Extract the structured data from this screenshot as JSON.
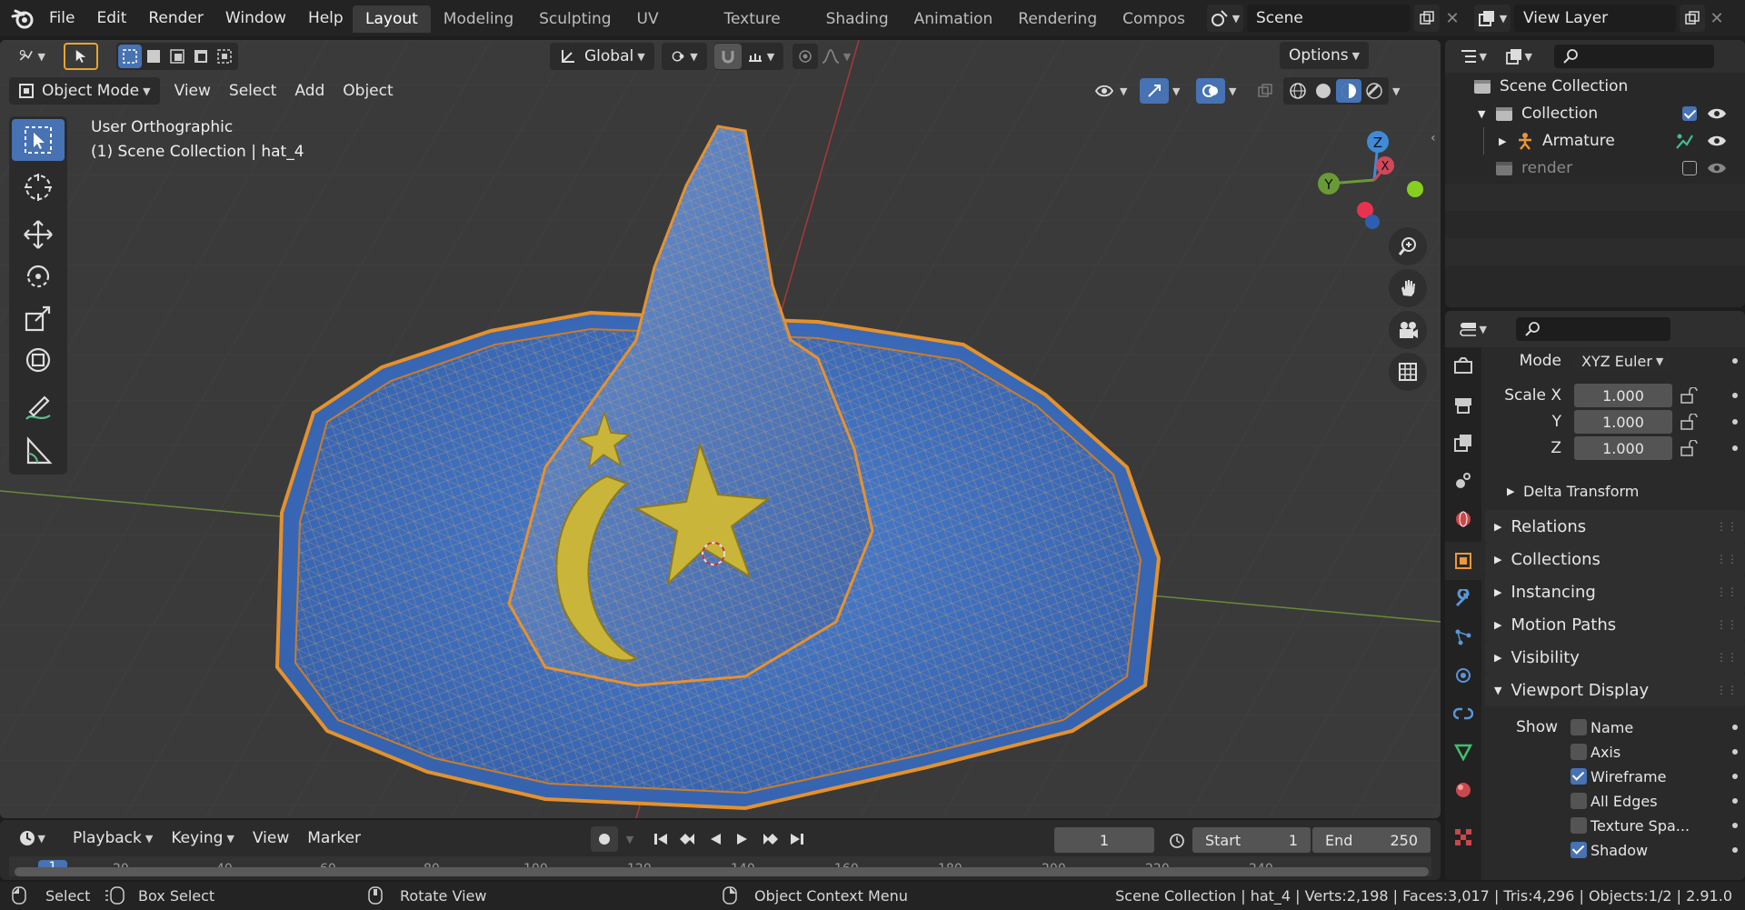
{
  "topbar": {
    "menus": [
      "File",
      "Edit",
      "Render",
      "Window",
      "Help"
    ],
    "workspaces": [
      "Layout",
      "Modeling",
      "Sculpting",
      "UV Editing",
      "Texture Paint",
      "Shading",
      "Animation",
      "Rendering",
      "Compos"
    ],
    "active_workspace": "Layout",
    "scene_label": "Scene",
    "view_layer_label": "View Layer"
  },
  "viewport": {
    "transform_orientation": "Global",
    "options_label": "Options",
    "mode_label": "Object Mode",
    "header_menus": [
      "View",
      "Select",
      "Add",
      "Object"
    ],
    "view_name": "User Orthographic",
    "context_line": "(1) Scene Collection | hat_4",
    "gizmo": {
      "z": "Z",
      "y": "Y",
      "x": "X"
    }
  },
  "outliner": {
    "items": [
      {
        "label": "Scene Collection"
      },
      {
        "label": "Collection"
      },
      {
        "label": "Armature"
      },
      {
        "label": "render"
      }
    ]
  },
  "properties": {
    "mode_label": "Mode",
    "mode_value": "XYZ Euler",
    "scale_x_label": "Scale X",
    "scale_y_label": "Y",
    "scale_z_label": "Z",
    "scale_x": "1.000",
    "scale_y": "1.000",
    "scale_z": "1.000",
    "delta_transform": "Delta Transform",
    "panels": [
      "Relations",
      "Collections",
      "Instancing",
      "Motion Paths",
      "Visibility",
      "Viewport Display"
    ],
    "show_label": "Show",
    "show_items": [
      {
        "label": "Name",
        "checked": false
      },
      {
        "label": "Axis",
        "checked": false
      },
      {
        "label": "Wireframe",
        "checked": true
      },
      {
        "label": "All Edges",
        "checked": false
      },
      {
        "label": "Texture Spa...",
        "checked": false
      },
      {
        "label": "Shadow",
        "checked": true
      }
    ]
  },
  "timeline": {
    "menus": [
      "Playback",
      "Keying",
      "View",
      "Marker"
    ],
    "current_frame": "1",
    "start_label": "Start",
    "start_value": "1",
    "end_label": "End",
    "end_value": "250",
    "ruler_marks": [
      "1",
      "20",
      "40",
      "60",
      "80",
      "100",
      "120",
      "140",
      "160",
      "180",
      "200",
      "220",
      "240"
    ]
  },
  "statusbar": {
    "select": "Select",
    "box_select": "Box Select",
    "rotate_view": "Rotate View",
    "context_menu": "Object Context Menu",
    "info": "Scene Collection | hat_4 | Verts:2,198 | Faces:3,017 | Tris:4,296 | Objects:1/2 | 2.91.0"
  },
  "colors": {
    "accent": "#4772b3",
    "viewport_bg": "#3a3a3a",
    "selection_outline": "#e5912c",
    "hat_blue": "#3f74c8",
    "star_yellow": "#c9b53a"
  }
}
